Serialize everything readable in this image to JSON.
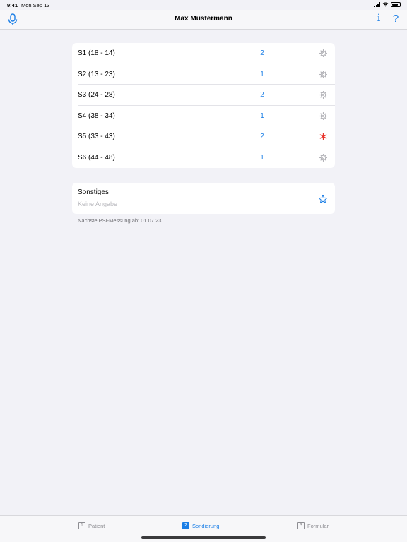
{
  "status_bar": {
    "time": "9:41",
    "date": "Mon Sep 13"
  },
  "nav": {
    "title": "Max Mustermann",
    "info_label": "i",
    "help_label": "?"
  },
  "sextants": [
    {
      "label": "S1  (18 - 14)",
      "value": "2",
      "icon": "gear-icon",
      "icon_color": "#b0b0b5"
    },
    {
      "label": "S2  (13 - 23)",
      "value": "1",
      "icon": "gear-icon",
      "icon_color": "#b0b0b5"
    },
    {
      "label": "S3  (24 - 28)",
      "value": "2",
      "icon": "gear-icon",
      "icon_color": "#b0b0b5"
    },
    {
      "label": "S4  (38 - 34)",
      "value": "1",
      "icon": "gear-icon",
      "icon_color": "#b0b0b5"
    },
    {
      "label": "S5  (33 - 43)",
      "value": "2",
      "icon": "asterisk-icon",
      "icon_color": "#e8332a"
    },
    {
      "label": "S6  (44 - 48)",
      "value": "1",
      "icon": "gear-icon",
      "icon_color": "#b0b0b5"
    }
  ],
  "misc": {
    "title": "Sonstiges",
    "value": "Keine Angabe"
  },
  "psi_note": "Nächste PSI-Messung ab: 01.07.23",
  "tabs": [
    {
      "num": "1",
      "label": "Patient",
      "active": false
    },
    {
      "num": "2",
      "label": "Sondierung",
      "active": true
    },
    {
      "num": "3",
      "label": "Formular",
      "active": false
    }
  ],
  "colors": {
    "accent": "#1a7ee6",
    "alert": "#e8332a",
    "background": "#f2f2f7"
  }
}
